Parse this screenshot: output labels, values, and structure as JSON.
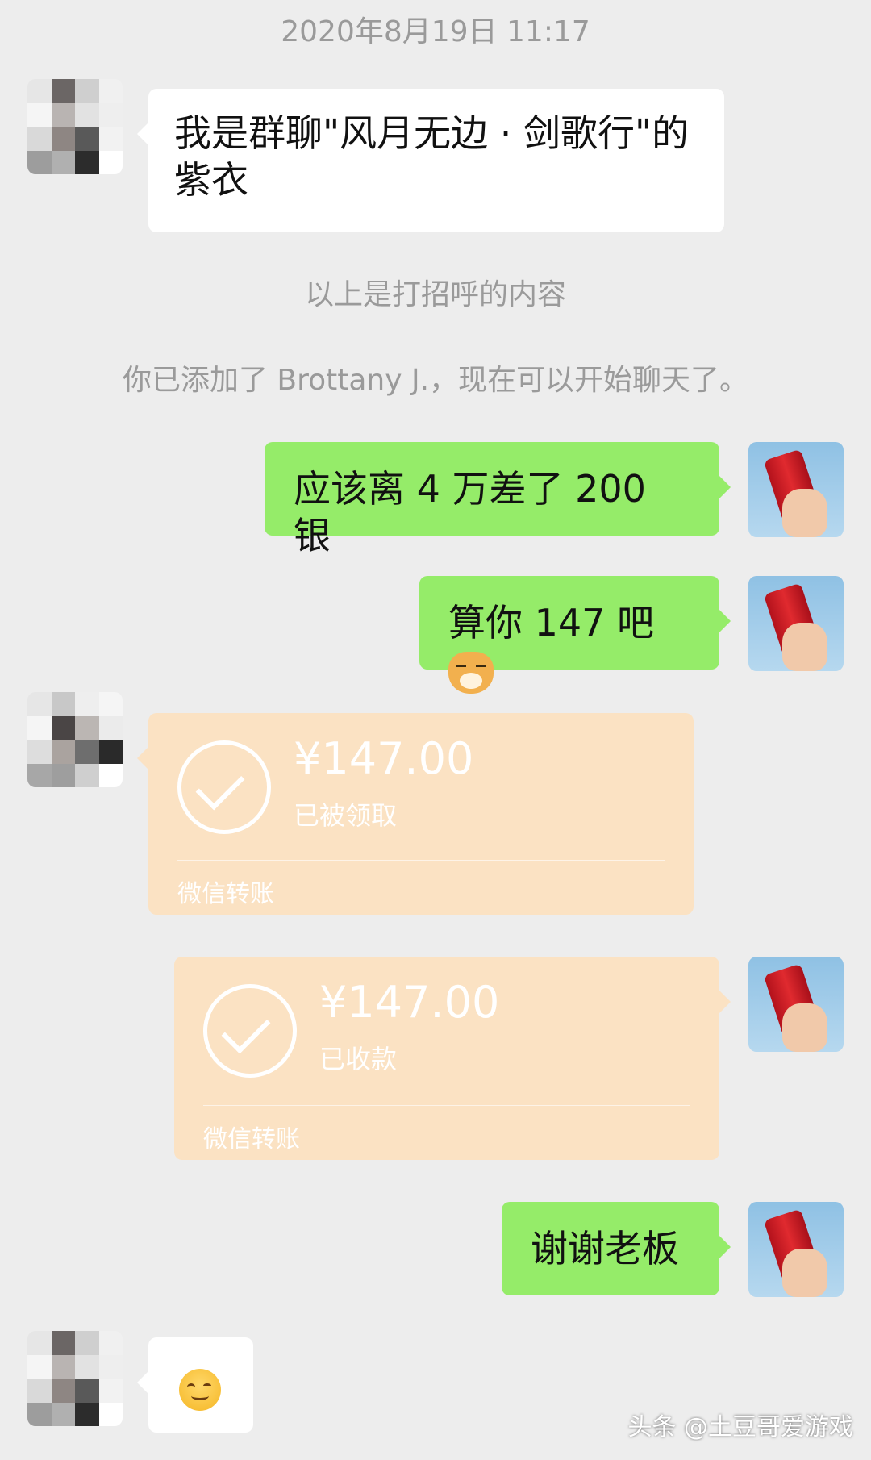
{
  "chat": {
    "timestamp": "2020年8月19日 11:17",
    "greeting_text": "我是群聊\"风月无边 · 剑歌行\"的紫衣",
    "system_note_1": "以上是打招呼的内容",
    "system_note_2": "你已添加了 Brottany  J.，现在可以开始聊天了。",
    "msg_1": "应该离 4 万差了 200 银",
    "msg_2": "算你 147 吧",
    "msg_2_emoji": "dog-emoji",
    "transfer_1": {
      "amount": "¥147.00",
      "status": "已被领取",
      "label": "微信转账"
    },
    "transfer_2": {
      "amount": "¥147.00",
      "status": "已收款",
      "label": "微信转账"
    },
    "msg_3": "谢谢老板",
    "msg_4_emoji": "smile-emoji"
  },
  "watermark": "头条 @土豆哥爱游戏",
  "colors": {
    "background": "#ededed",
    "sent_bubble": "#95ec69",
    "received_bubble": "#ffffff",
    "transfer_bubble": "#fbe2c3",
    "system_text": "#9a9a9a"
  }
}
